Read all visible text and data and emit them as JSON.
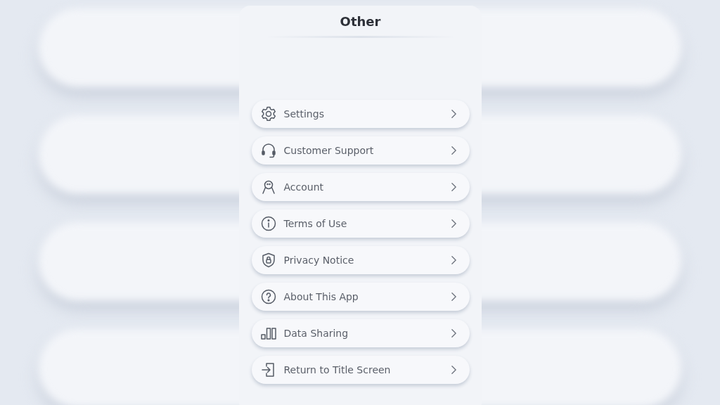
{
  "panel": {
    "title": "Other"
  },
  "items": [
    {
      "label": "Settings",
      "kind": "gear"
    },
    {
      "label": "Customer Support",
      "kind": "headset"
    },
    {
      "label": "Account",
      "kind": "person"
    },
    {
      "label": "Terms of Use",
      "kind": "info"
    },
    {
      "label": "Privacy Notice",
      "kind": "shield"
    },
    {
      "label": "About This App",
      "kind": "question"
    },
    {
      "label": "Data Sharing",
      "kind": "bars"
    },
    {
      "label": "Return to Title Screen",
      "kind": "exit"
    }
  ]
}
